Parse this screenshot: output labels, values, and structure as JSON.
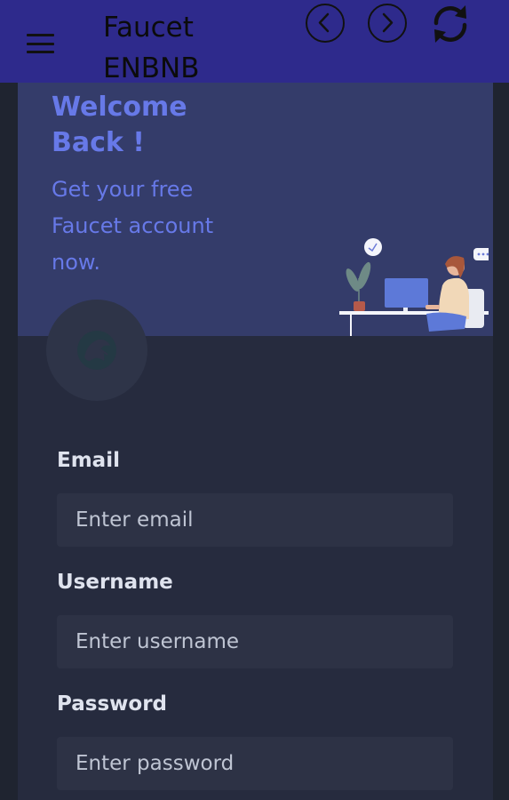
{
  "header": {
    "title_line1": "Faucet",
    "title_line2": "ENBNB",
    "menu_icon": "hamburger-icon",
    "back_icon": "chevron-left-icon",
    "forward_icon": "chevron-right-icon",
    "refresh_icon": "refresh-icon"
  },
  "hero": {
    "title": "Welcome Back !",
    "subtitle": "Get your free Faucet account now."
  },
  "form": {
    "email_label": "Email",
    "email_placeholder": "Enter email",
    "username_label": "Username",
    "username_placeholder": "Enter username",
    "password_label": "Password",
    "password_placeholder": "Enter password"
  },
  "colors": {
    "topbar": "#2e2a8c",
    "hero_bg": "#343c6a",
    "accent_text": "#6779e8",
    "card_bg": "#262b3e",
    "input_bg": "#2d3245"
  }
}
